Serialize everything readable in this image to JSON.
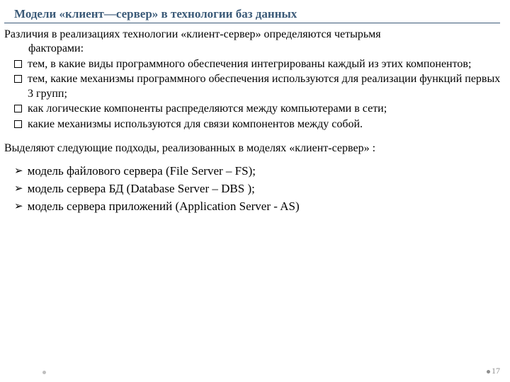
{
  "title": "Модели «клиент—сервер» в технологии баз данных",
  "intro": {
    "lead": "Различия в реализациях технологии «клиент-сервер» определяются четырьмя",
    "factors": "факторами:"
  },
  "factor_items": [
    "тем, в какие виды программного обеспечения интегрированы каждый из этих компонентов;",
    "тем, какие механизмы программного обеспечения  используются для реализации функций первых 3 групп;",
    "как логические компоненты распределяются между компьютерами в сети;",
    "какие механизмы используются для связи компонентов между собой."
  ],
  "approaches_intro": "Выделяют следующие подходы, реализованных в моделях «клиент-сервер» :",
  "approach_items": [
    "модель файлового сервера    (File Server – FS);",
    "модель сервера БД    (Database Server – DBS );",
    "модель сервера приложений    (Application Server  - AS)"
  ],
  "page_number": "17"
}
